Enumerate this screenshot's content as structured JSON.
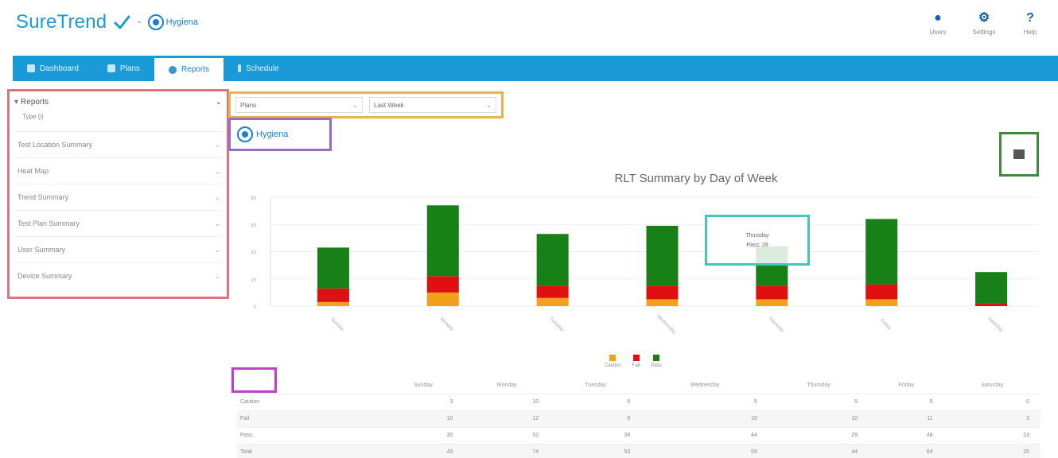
{
  "header": {
    "brand": "SureTrend",
    "partner_name": "Hygiena",
    "actions": [
      {
        "icon": "user-icon",
        "label": "Users"
      },
      {
        "icon": "settings-icon",
        "label": "Settings"
      },
      {
        "icon": "help-icon",
        "label": "Help"
      }
    ]
  },
  "nav": {
    "tabs": [
      {
        "label": "Dashboard",
        "icon": "home-icon"
      },
      {
        "label": "Plans",
        "icon": "plans-icon"
      },
      {
        "label": "Reports",
        "icon": "reports-icon"
      },
      {
        "label": "Schedule",
        "icon": "schedule-icon"
      }
    ],
    "active_index": 2
  },
  "sidebar": {
    "title": "Reports",
    "subtitle": "Type (i)",
    "items": [
      "Test Location Summary",
      "Heat Map",
      "Trend Summary",
      "Test Plan Summary",
      "User Summary",
      "Device Summary"
    ]
  },
  "filters": {
    "plan": "Plans",
    "period": "Last Week"
  },
  "chart_data": {
    "type": "bar",
    "stacked": true,
    "title": "RLT Summary by Day of Week",
    "categories": [
      "Sunday",
      "Monday",
      "Tuesday",
      "Wednesday",
      "Thursday",
      "Friday",
      "Saturday"
    ],
    "series": [
      {
        "name": "Caution",
        "color": "#f5a01a",
        "values": [
          3,
          10,
          6,
          5,
          5,
          5,
          0
        ]
      },
      {
        "name": "Fail",
        "color": "#e01010",
        "values": [
          10,
          12,
          9,
          10,
          10,
          11,
          2
        ]
      },
      {
        "name": "Pass",
        "color": "#178017",
        "values": [
          30,
          52,
          38,
          44,
          29,
          48,
          23
        ]
      }
    ],
    "ylim": [
      0,
      80
    ],
    "y_ticks": [
      0,
      20,
      40,
      60,
      80
    ],
    "grid": true,
    "legend": "bottom-center"
  },
  "tooltip": {
    "line1": "Thursday",
    "line2": "Pass: 29"
  },
  "table": {
    "columns": [
      "",
      "Sunday",
      "Monday",
      "Tuesday",
      "Wednesday",
      "Thursday",
      "Friday",
      "Saturday"
    ],
    "rows": [
      [
        "Caution",
        "3",
        "10",
        "6",
        "5",
        "5",
        "5",
        "0"
      ],
      [
        "Fail",
        "10",
        "12",
        "9",
        "10",
        "10",
        "11",
        "2"
      ],
      [
        "Pass",
        "30",
        "52",
        "38",
        "44",
        "29",
        "48",
        "23"
      ],
      [
        "Total",
        "43",
        "74",
        "53",
        "59",
        "44",
        "64",
        "25"
      ]
    ]
  }
}
